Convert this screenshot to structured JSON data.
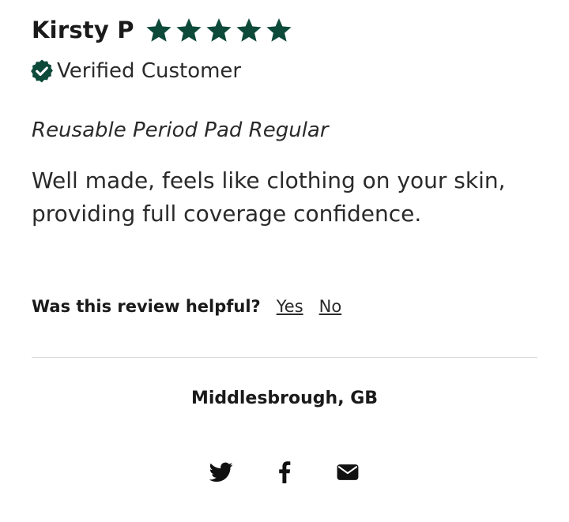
{
  "review": {
    "author": "Kirsty P",
    "rating": 5,
    "rating_max": 5,
    "verified_label": "Verified Customer",
    "product": "Reusable Period Pad Regular",
    "body": "Well made, feels like clothing on your skin, providing full coverage confidence."
  },
  "helpful": {
    "question": "Was this review helpful?",
    "yes_label": "Yes",
    "no_label": "No"
  },
  "location": "Middlesbrough, GB",
  "share": {
    "icons": [
      "twitter-icon",
      "facebook-icon",
      "email-icon"
    ]
  },
  "colors": {
    "star": "#0e4a3a",
    "badge": "#0e4a3a",
    "text": "#2a2a2a",
    "divider": "#d9d9d9"
  }
}
